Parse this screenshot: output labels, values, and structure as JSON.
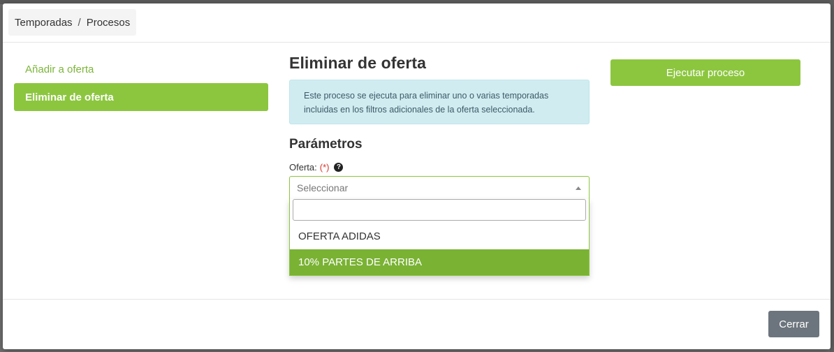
{
  "breadcrumb": {
    "items": [
      "Temporadas",
      "Procesos"
    ],
    "separator": "/"
  },
  "sidebar": {
    "items": [
      {
        "label": "Añadir a oferta",
        "active": false
      },
      {
        "label": "Eliminar de oferta",
        "active": true
      }
    ]
  },
  "main": {
    "title": "Eliminar de oferta",
    "info": "Este proceso se ejecuta para eliminar uno o varias temporadas incluidas en los filtros adicionales de la oferta seleccionada.",
    "params_title": "Parámetros",
    "field": {
      "label": "Oferta:",
      "required_mark": "(*)",
      "help_icon": "question-circle-icon",
      "placeholder": "Seleccionar",
      "search_value": "",
      "options": [
        "OFERTA ADIDAS",
        "10% PARTES DE ARRIBA"
      ],
      "highlighted_option": "10% PARTES DE ARRIBA"
    }
  },
  "actions": {
    "execute_label": "Ejecutar proceso",
    "close_label": "Cerrar"
  },
  "colors": {
    "accent": "#8cc63f",
    "highlight": "#7ab234",
    "info_bg": "#d1ecf1",
    "close_bg": "#6c757d",
    "required": "#d9342b"
  }
}
